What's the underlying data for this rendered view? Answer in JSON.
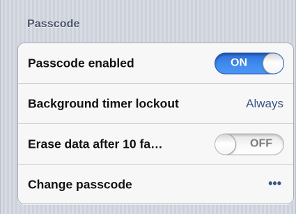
{
  "section": {
    "title": "Passcode"
  },
  "rows": [
    {
      "label": "Passcode enabled",
      "toggle": {
        "state": "on",
        "text": "ON"
      }
    },
    {
      "label": "Background timer lockout",
      "value": "Always"
    },
    {
      "label": "Erase data after 10 fa…",
      "toggle": {
        "state": "off",
        "text": "OFF"
      }
    },
    {
      "label": "Change passcode",
      "value_icon": "ellipsis-icon",
      "value": "•••"
    }
  ],
  "colors": {
    "toggle_on": "#3f8cf0",
    "value_text": "#385487",
    "section_header": "#4c566c"
  }
}
